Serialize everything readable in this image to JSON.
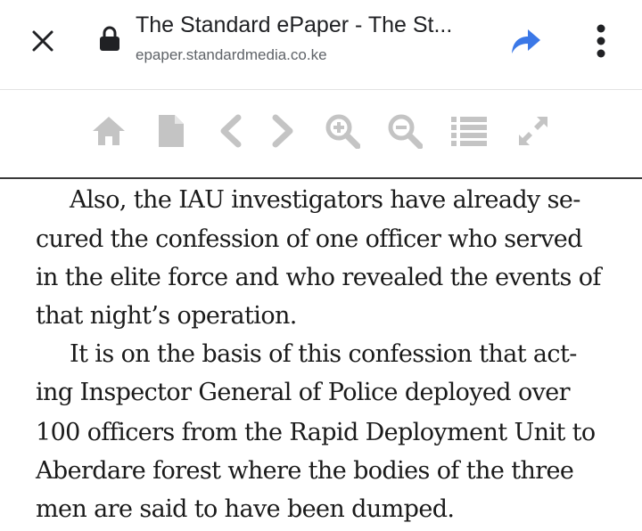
{
  "browser": {
    "page_title": "The Standard ePaper - The St...",
    "url": "epaper.standardmedia.co.ke",
    "icons": {
      "close": "close-icon",
      "lock": "lock-icon",
      "share": "share-icon",
      "menu": "more-vert-icon"
    },
    "colors": {
      "share": "#3b78e7",
      "text": "#202124",
      "url": "#5f6368"
    }
  },
  "toolbar": {
    "icons": [
      "home-icon",
      "page-icon",
      "previous-icon",
      "next-icon",
      "zoom-in-icon",
      "zoom-out-icon",
      "list-icon",
      "fullscreen-icon"
    ],
    "icon_color": "#c4c4c4"
  },
  "article": {
    "lines": [
      "Also, the IAU investigators have already se-",
      "cured the confession of one officer who served",
      "in the elite force and who revealed the events of",
      "that night’s operation.",
      "It is on the basis of this confession that act-",
      "ing Inspector General of Police deployed over",
      "100 officers from the Rapid Deployment Unit to",
      "Aberdare forest where the bodies of the three",
      "men are said to have been dumped."
    ]
  }
}
